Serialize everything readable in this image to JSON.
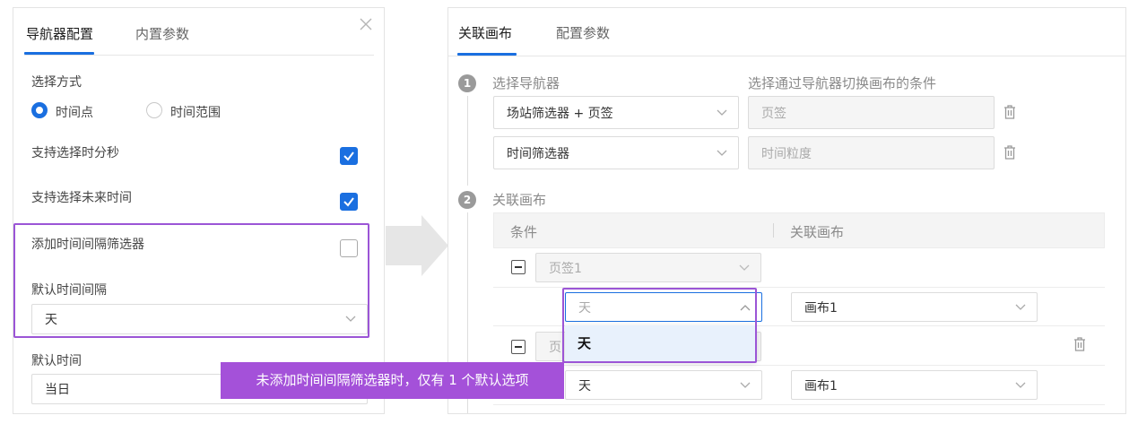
{
  "left_panel": {
    "tabs": [
      {
        "label": "导航器配置",
        "active": true
      },
      {
        "label": "内置参数",
        "active": false
      }
    ],
    "close_icon": "close-icon",
    "select_mode": {
      "label": "选择方式",
      "options": [
        {
          "label": "时间点",
          "checked": true
        },
        {
          "label": "时间范围",
          "checked": false
        }
      ]
    },
    "support_hms": {
      "label": "支持选择时分秒",
      "checked": true
    },
    "support_future": {
      "label": "支持选择未来时间",
      "checked": true
    },
    "add_interval": {
      "label": "添加时间间隔筛选器",
      "checked": false
    },
    "default_interval": {
      "label": "默认时间间隔",
      "value": "天"
    },
    "default_time": {
      "label": "默认时间",
      "value": "当日"
    }
  },
  "right_panel": {
    "tabs": [
      {
        "label": "关联画布",
        "active": true
      },
      {
        "label": "配置参数",
        "active": false
      }
    ],
    "step1": {
      "number": "1",
      "title": "选择导航器",
      "condition_title": "选择通过导航器切换画布的条件",
      "rows": [
        {
          "navigator": "场站筛选器 + 页签",
          "condition": "页签"
        },
        {
          "navigator": "时间筛选器",
          "condition": "时间粒度"
        }
      ]
    },
    "step2": {
      "number": "2",
      "title": "关联画布",
      "table_headers": {
        "condition": "条件",
        "canvas": "关联画布"
      },
      "group1": {
        "label": "页签1",
        "sub_value": "天",
        "canvas": "画布1"
      },
      "group2": {
        "label": "页",
        "sub_value": "天",
        "canvas": "画布1"
      },
      "dropdown_option": "天"
    }
  },
  "tooltip": "未添加时间间隔筛选器时，仅有 1 个默认选项",
  "colors": {
    "accent": "#1a6fe0",
    "highlight": "#9b55d6",
    "tooltip_bg": "#a451d9"
  }
}
